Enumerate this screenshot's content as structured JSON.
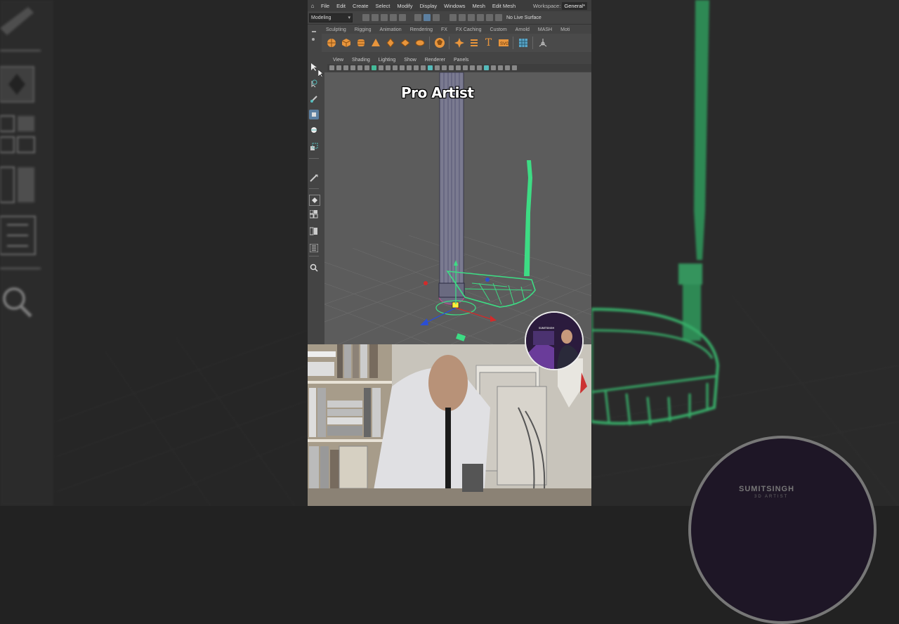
{
  "menubar": {
    "items": [
      "File",
      "Edit",
      "Create",
      "Select",
      "Modify",
      "Display",
      "Windows",
      "Mesh",
      "Edit Mesh"
    ],
    "workspace_label": "Workspace:",
    "workspace_value": "General*"
  },
  "statusline": {
    "mode": "Modeling",
    "live_surface": "No Live Surface"
  },
  "shelf": {
    "tabs": [
      "Sculpting",
      "Rigging",
      "Animation",
      "Rendering",
      "FX",
      "FX Caching",
      "Custom",
      "Arnold",
      "MASH",
      "Moti"
    ]
  },
  "panel": {
    "menus": [
      "View",
      "Shading",
      "Lighting",
      "Show",
      "Renderer",
      "Panels"
    ]
  },
  "caption": "Pro Artist",
  "channel": {
    "name": "SUMITSINGH",
    "tagline": "3D ARTIST"
  },
  "colors": {
    "accent_green": "#3ddc84",
    "maya_bg": "#444444",
    "viewport_bg": "#5c5c5c",
    "shelf_orange": "#e8953c"
  }
}
